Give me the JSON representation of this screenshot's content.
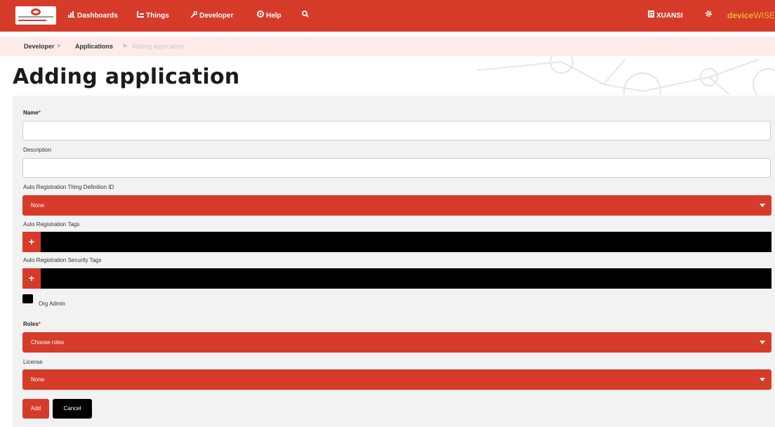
{
  "nav": {
    "items": [
      {
        "label": "Dashboards",
        "icon": "chart-icon"
      },
      {
        "label": "Things",
        "icon": "things-icon"
      },
      {
        "label": "Developer",
        "icon": "wrench-icon"
      },
      {
        "label": "Help",
        "icon": "help-icon"
      }
    ],
    "search_icon": "search-icon",
    "org_label": "XUANSI",
    "settings_icon": "gear-icon",
    "brand_part1": "device",
    "brand_part2": "WISE"
  },
  "breadcrumb": {
    "items": [
      "Developer",
      "Applications",
      "Adding application"
    ]
  },
  "page": {
    "title": "Adding application"
  },
  "form": {
    "name_label": "Name",
    "name_value": "",
    "description_label": "Description",
    "description_value": "",
    "thing_def_label": "Auto Registration Thing Definition ID",
    "thing_def_value": "None",
    "tags_label": "Auto Registration Tags",
    "security_tags_label": "Auto Registration Security Tags",
    "org_admin_label": "Org Admin",
    "roles_label": "Roles",
    "roles_value": "Choose roles",
    "license_label": "License",
    "license_value": "None",
    "add_label": "Add",
    "cancel_label": "Cancel",
    "plus_symbol": "+",
    "required_mark": "*"
  },
  "colors": {
    "accent": "#d63b2a",
    "breadcrumb_bg": "#fbecea",
    "brand": "#f3b233"
  }
}
